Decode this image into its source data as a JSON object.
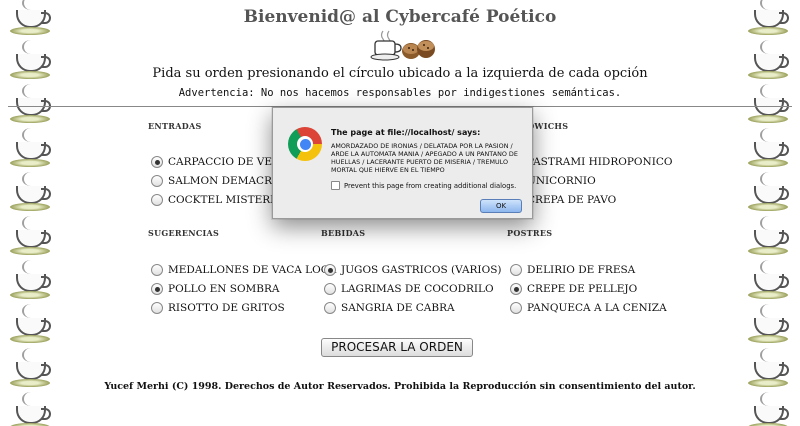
{
  "header": {
    "title": "Bienvenid@ al Cybercafé Poético",
    "instructions": "Pida su orden presionando el círculo ubicado a la izquierda de cada opción",
    "warning": "Advertencia: No nos hacemos responsables por indigestiones semánticas."
  },
  "sections": {
    "entradas": {
      "title": "ENTRADAS",
      "items": [
        {
          "label": "CARPACCIO DE VERRUGAS",
          "selected": true
        },
        {
          "label": "SALMON DEMACRADO",
          "selected": false
        },
        {
          "label": "COCKTEL MISTERIOSO",
          "selected": false
        }
      ]
    },
    "sandwiches": {
      "title": "SANDWICHS",
      "items": [
        {
          "label": "PASTRAMI HIDROPONICO",
          "selected": true
        },
        {
          "label": "UNICORNIO",
          "selected": false
        },
        {
          "label": "CREPA DE PAVO",
          "selected": false
        }
      ]
    },
    "sugerencias": {
      "title": "SUGERENCIAS",
      "items": [
        {
          "label": "MEDALLONES DE VACA LOCA",
          "selected": false
        },
        {
          "label": "POLLO EN SOMBRA",
          "selected": true
        },
        {
          "label": "RISOTTO DE GRITOS",
          "selected": false
        }
      ]
    },
    "bebidas": {
      "title": "BEBIDAS",
      "items": [
        {
          "label": "JUGOS GASTRICOS (VARIOS)",
          "selected": true
        },
        {
          "label": "LAGRIMAS DE COCODRILO",
          "selected": false
        },
        {
          "label": "SANGRIA DE CABRA",
          "selected": false
        }
      ]
    },
    "postres": {
      "title": "POSTRES",
      "items": [
        {
          "label": "DELIRIO DE FRESA",
          "selected": false
        },
        {
          "label": "CREPE DE PELLEJO",
          "selected": true
        },
        {
          "label": "PANQUECA A LA CENIZA",
          "selected": false
        }
      ]
    }
  },
  "submit_label": "PROCESAR LA ORDEN",
  "footer": "Yucef Merhi (C) 1998. Derechos de Autor Reservados. Prohibida la Reproducción sin consentimiento del autor.",
  "dialog": {
    "title": "The page at file://localhost/ says:",
    "message": "AMORDAZADO DE IRONIAS / DELATADA POR LA PASION / ARDE LA AUTOMATA MANIA / APEGADO A UN PANTANO DE HUELLAS / LACERANTE PUERTO DE MISERIA / TREMULO MORTAL QUE HIERVE EN EL TIEMPO",
    "checkbox_label": "Prevent this page from creating additional dialogs.",
    "ok_label": "OK",
    "icon": "chrome-icon"
  }
}
